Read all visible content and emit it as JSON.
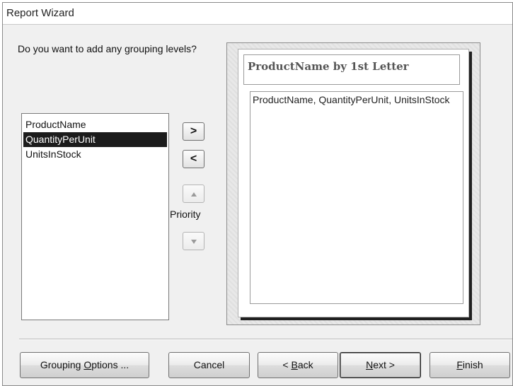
{
  "window": {
    "title": "Report Wizard"
  },
  "prompt": {
    "text": "Do you want to add any grouping levels?"
  },
  "available_fields": {
    "items": [
      "ProductName",
      "QuantityPerUnit",
      "UnitsInStock"
    ],
    "selected": "QuantityPerUnit"
  },
  "move_buttons": {
    "add_label": ">",
    "remove_label": "<",
    "priority_label": "Priority"
  },
  "preview": {
    "group_header": "ProductName by 1st Letter",
    "detail_fields": "ProductName, QuantityPerUnit, UnitsInStock"
  },
  "buttons": {
    "grouping_options": {
      "before": "Grouping ",
      "mnemonic": "O",
      "after": "ptions ..."
    },
    "cancel": "Cancel",
    "back": {
      "before": "< ",
      "mnemonic": "B",
      "after": "ack"
    },
    "next": {
      "before": "",
      "mnemonic": "N",
      "after": "ext >"
    },
    "finish": {
      "before": "",
      "mnemonic": "F",
      "after": "inish"
    }
  },
  "colors": {
    "selection_bg": "#1c1c1c",
    "dialog_bg": "#f0f0f0",
    "shadow": "#202020"
  }
}
